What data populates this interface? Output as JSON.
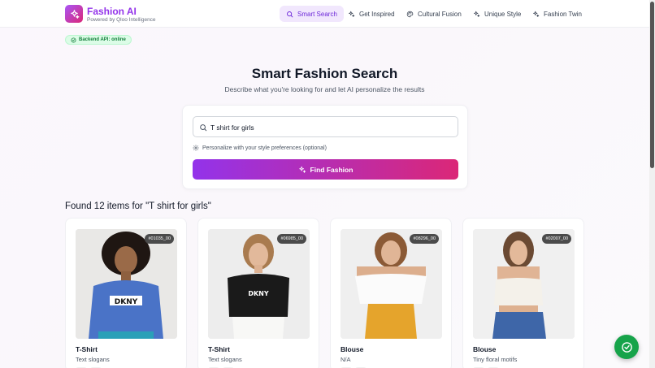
{
  "brand": {
    "title": "Fashion AI",
    "subtitle": "Powered by Qloo Intelligence"
  },
  "nav": [
    {
      "label": "Smart Search",
      "icon": "search-icon",
      "active": true
    },
    {
      "label": "Get Inspired",
      "icon": "sparkles-icon",
      "active": false
    },
    {
      "label": "Cultural Fusion",
      "icon": "palette-icon",
      "active": false
    },
    {
      "label": "Unique Style",
      "icon": "sparkles-icon",
      "active": false
    },
    {
      "label": "Fashion Twin",
      "icon": "sparkles-icon",
      "active": false
    }
  ],
  "status": {
    "label": "Backend API: online",
    "color": "#15803d"
  },
  "hero": {
    "title": "Smart Fashion Search",
    "subtitle": "Describe what you're looking for and let AI personalize the results"
  },
  "search": {
    "value": "T shirt for girls",
    "personalize_label": "Personalize with your style preferences (optional)",
    "button_label": "Find Fashion"
  },
  "results": {
    "summary": "Found 12 items for \"T shirt for girls\"",
    "items": [
      {
        "id": "#01035_00",
        "type": "T-Shirt",
        "desc": "Text slogans"
      },
      {
        "id": "#06985_00",
        "type": "T-Shirt",
        "desc": "Text slogans"
      },
      {
        "id": "#08296_00",
        "type": "Blouse",
        "desc": "N/A"
      },
      {
        "id": "#02007_00",
        "type": "Blouse",
        "desc": "Tiny floral motifs"
      }
    ]
  },
  "colors": {
    "accent": "#9333ea",
    "accent2": "#db2777",
    "success": "#16a34a"
  }
}
